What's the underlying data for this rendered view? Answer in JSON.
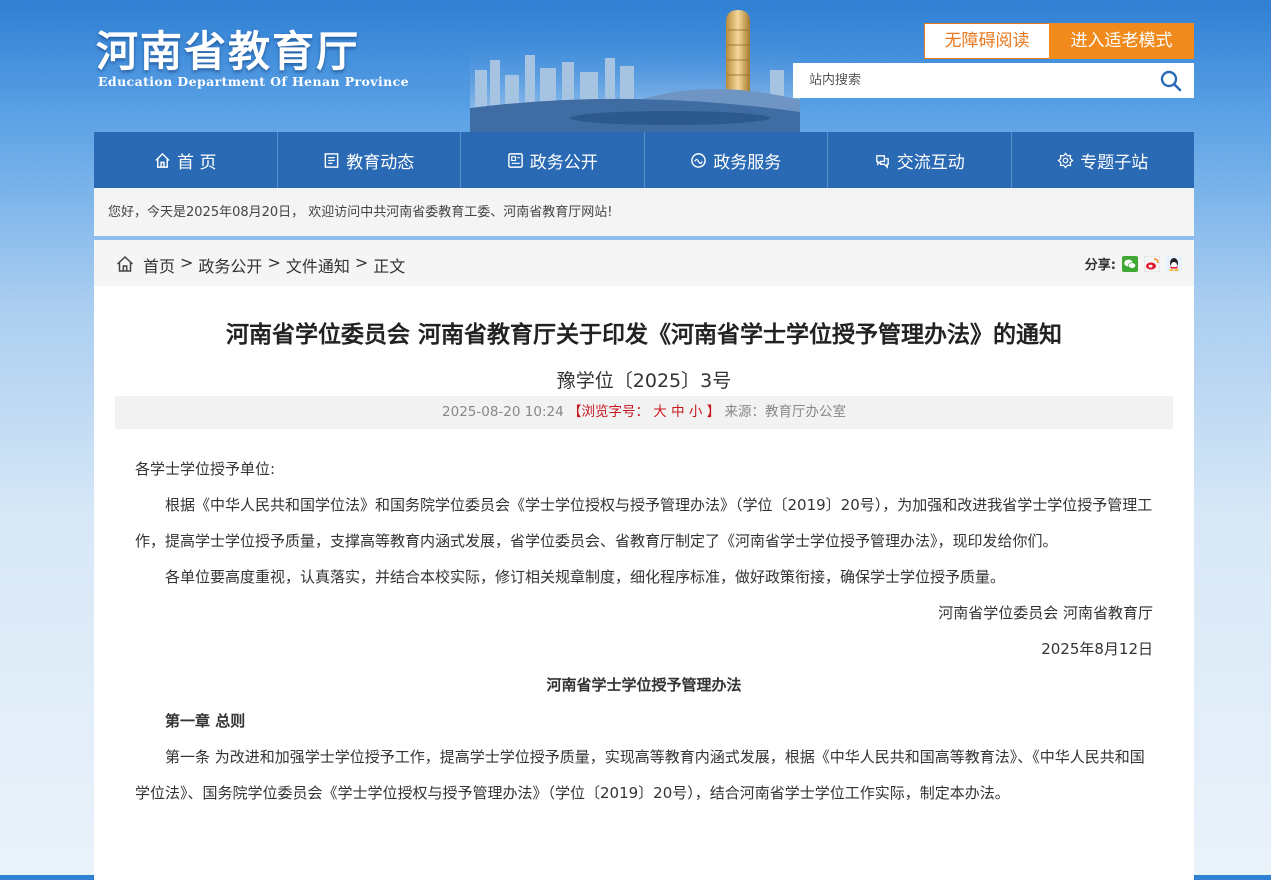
{
  "header": {
    "logo_cn": "河南省教育厅",
    "logo_en": "Education Department Of Henan Province",
    "accessibility_label": "无障碍阅读",
    "elder_mode_label": "进入适老模式",
    "search_placeholder": "站内搜索"
  },
  "nav": [
    {
      "label": "首 页",
      "icon": "home-icon"
    },
    {
      "label": "教育动态",
      "icon": "news-icon"
    },
    {
      "label": "政务公开",
      "icon": "gov-open-icon"
    },
    {
      "label": "政务服务",
      "icon": "service-icon"
    },
    {
      "label": "交流互动",
      "icon": "interact-icon"
    },
    {
      "label": "专题子站",
      "icon": "topic-icon"
    }
  ],
  "welcome": "您好，今天是2025年08月20日， 欢迎访问中共河南省委教育工委、河南省教育厅网站!",
  "breadcrumb": {
    "items": [
      "首页",
      "政务公开",
      "文件通知"
    ],
    "current": "正文",
    "sep": ">"
  },
  "share": {
    "label": "分享:",
    "icons": [
      "wechat-icon",
      "weibo-icon",
      "qq-icon"
    ]
  },
  "colors": {
    "nav": "#2a6ab4",
    "orange": "#f08a1c",
    "red": "#c8161d"
  },
  "article": {
    "title": "河南省学位委员会 河南省教育厅关于印发《河南省学士学位授予管理办法》的通知",
    "doc_no": "豫学位〔2025〕3号",
    "date": "2025-08-20 10:24",
    "font_size_label": "【浏览字号：",
    "font_size_large": "大",
    "font_size_medium": "中",
    "font_size_small": "小",
    "font_size_end": "】",
    "source": "来源：教育厅办公室",
    "salutation": "各学士学位授予单位:",
    "para1": "根据《中华人民共和国学位法》和国务院学位委员会《学士学位授权与授予管理办法》（学位〔2019〕20号），为加强和改进我省学士学位授予管理工作，提高学士学位授予质量，支撑高等教育内涵式发展，省学位委员会、省教育厅制定了《河南省学士学位授予管理办法》，现印发给你们。",
    "para2": "各单位要高度重视，认真落实，并结合本校实际，修订相关规章制度，细化程序标准，做好政策衔接，确保学士学位授予质量。",
    "signer": "河南省学位委员会 河南省教育厅",
    "sign_date": "2025年8月12日",
    "doc_title": "河南省学士学位授予管理办法",
    "chapter1": "第一章 总则",
    "article1": "第一条 为改进和加强学士学位授予工作，提高学士学位授予质量，实现高等教育内涵式发展，根据《中华人民共和国高等教育法》、《中华人民共和国学位法》、国务院学位委员会《学士学位授权与授予管理办法》（学位〔2019〕20号），结合河南省学士学位工作实际，制定本办法。"
  }
}
